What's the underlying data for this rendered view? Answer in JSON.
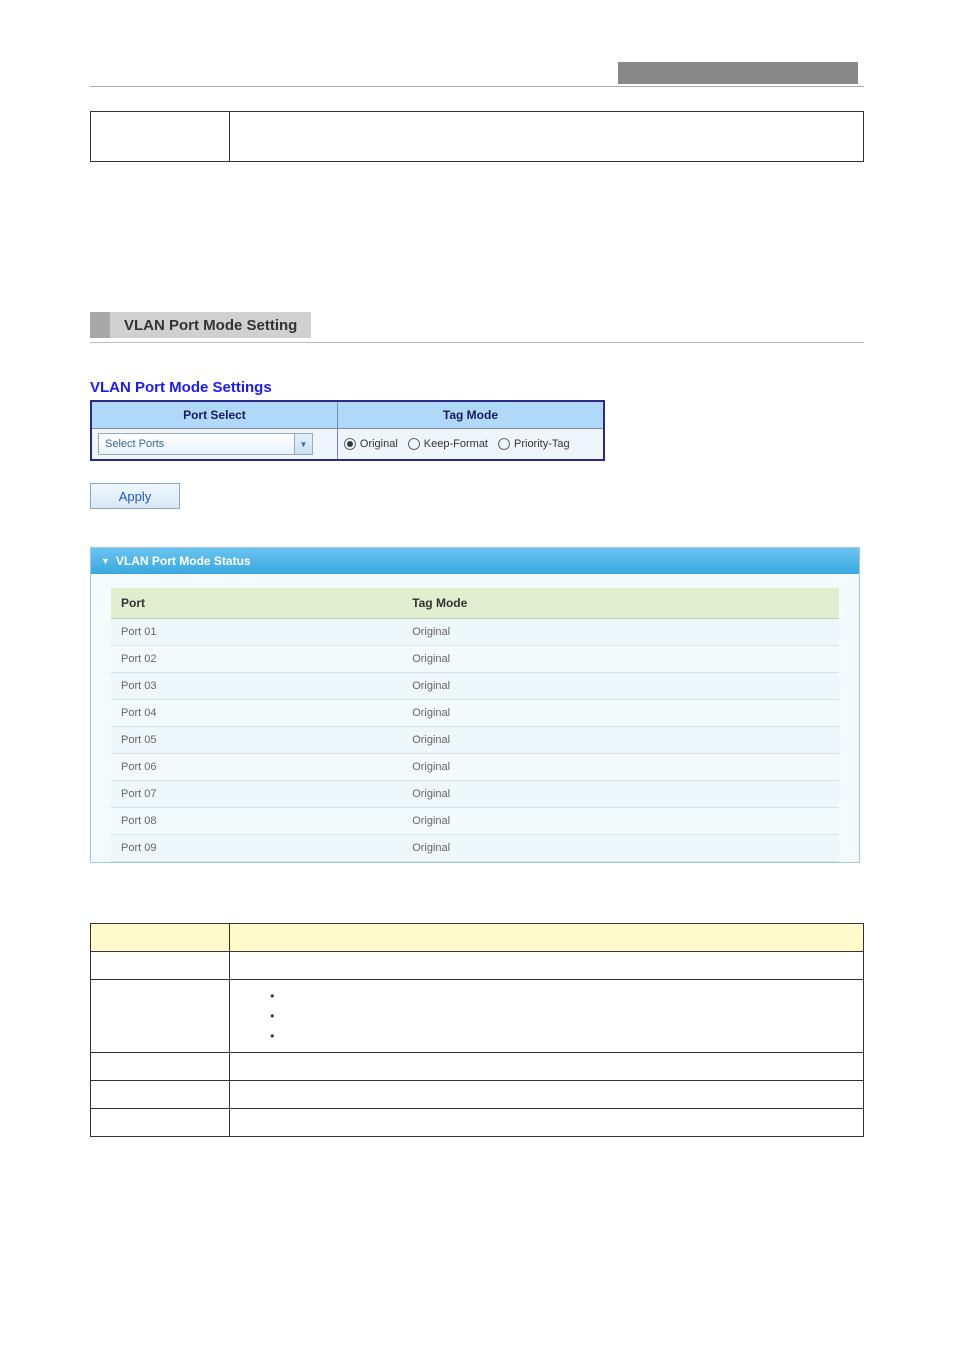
{
  "section": {
    "heading": "VLAN Port Mode Setting"
  },
  "settings": {
    "title": "VLAN Port Mode Settings",
    "headers": {
      "port_select": "Port Select",
      "tag_mode": "Tag Mode"
    },
    "dropdown_text": "Select Ports",
    "radios": {
      "original": "Original",
      "keep_format": "Keep-Format",
      "priority_tag": "Priority-Tag"
    },
    "apply_label": "Apply"
  },
  "status": {
    "title": "VLAN Port Mode Status",
    "headers": {
      "port": "Port",
      "tag_mode": "Tag Mode"
    },
    "rows": [
      {
        "port": "Port 01",
        "mode": "Original"
      },
      {
        "port": "Port 02",
        "mode": "Original"
      },
      {
        "port": "Port 03",
        "mode": "Original"
      },
      {
        "port": "Port 04",
        "mode": "Original"
      },
      {
        "port": "Port 05",
        "mode": "Original"
      },
      {
        "port": "Port 06",
        "mode": "Original"
      },
      {
        "port": "Port 07",
        "mode": "Original"
      },
      {
        "port": "Port 08",
        "mode": "Original"
      },
      {
        "port": "Port 09",
        "mode": "Original"
      }
    ]
  }
}
